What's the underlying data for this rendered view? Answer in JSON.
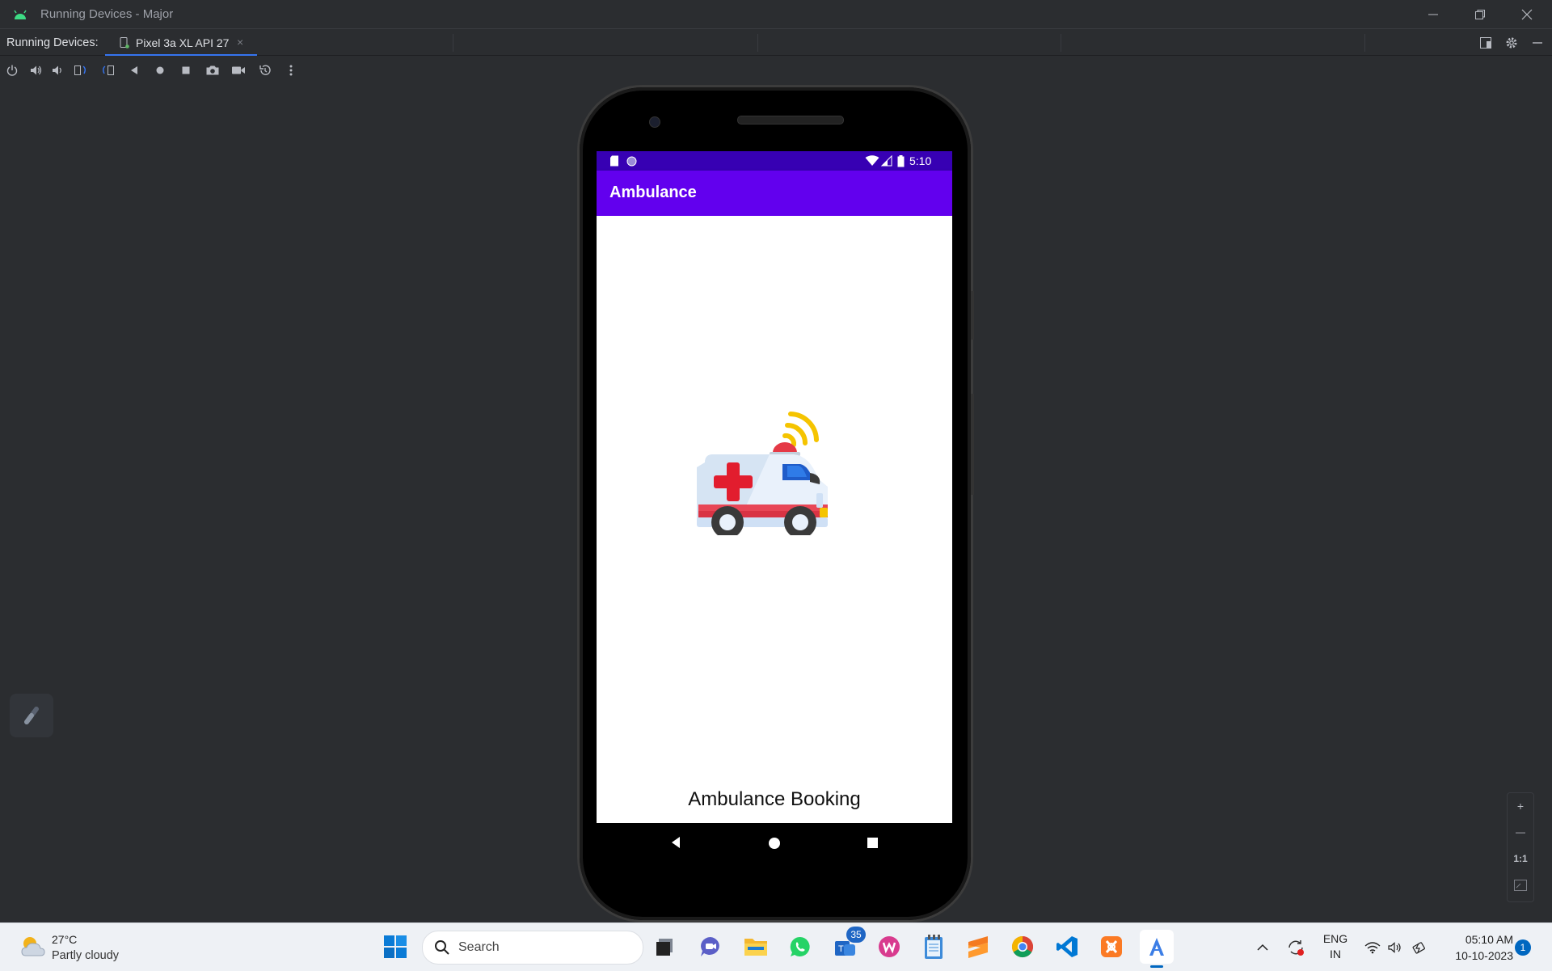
{
  "window": {
    "title": "Running Devices - Major"
  },
  "tabbar": {
    "label": "Running Devices:",
    "tab_label": "Pixel 3a XL API 27",
    "close_glyph": "×"
  },
  "device": {
    "status_time": "5:10",
    "app_title": "Ambulance",
    "booking_text": "Ambulance Booking"
  },
  "zoom": {
    "plus": "+",
    "minus": "—",
    "actual": "1:1"
  },
  "taskbar": {
    "temperature": "27°C",
    "condition": "Partly cloudy",
    "search_placeholder": "Search",
    "teams_badge": "35",
    "lang_line1": "ENG",
    "lang_line2": "IN",
    "time": "05:10 AM",
    "date": "10-10-2023",
    "notification_count": "1"
  },
  "colors": {
    "ide_bg": "#2b2d30",
    "accent": "#3574f0",
    "status_bar": "#3700b3",
    "app_bar": "#6200ee"
  }
}
